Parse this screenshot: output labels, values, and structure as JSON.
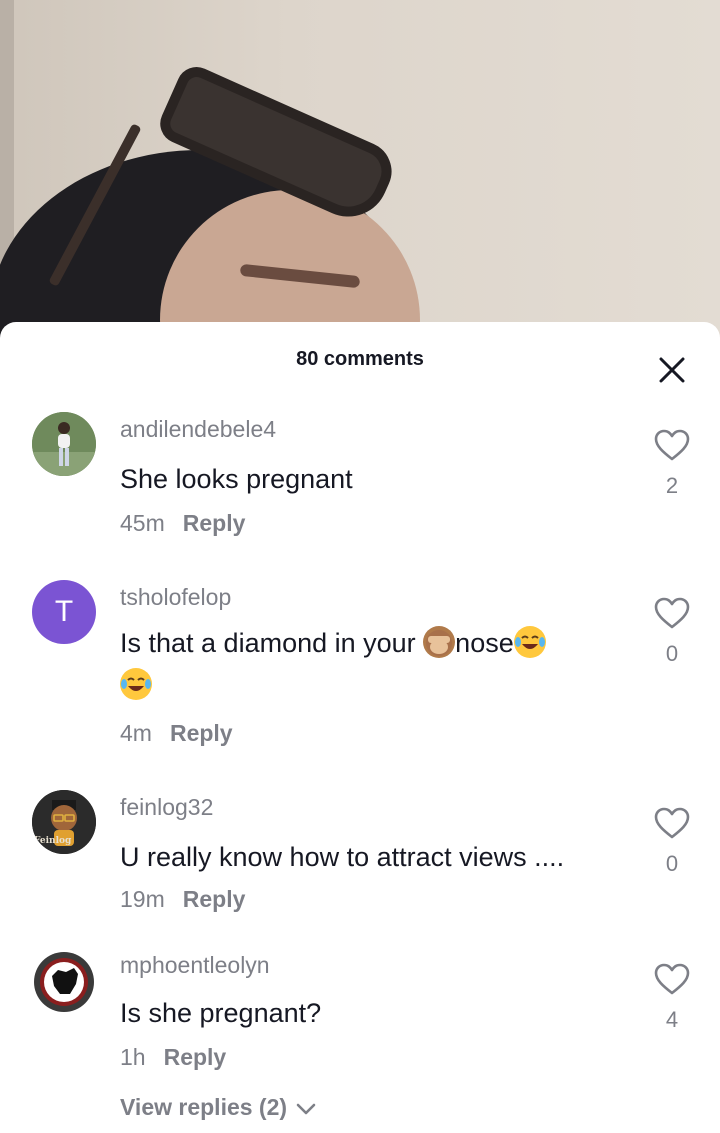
{
  "header": {
    "title": "80 comments"
  },
  "comments": [
    {
      "username": "andilendebele4",
      "text": "She looks pregnant",
      "time": "45m",
      "reply_label": "Reply",
      "likes": "2",
      "avatar_icon": "photo-avatar"
    },
    {
      "username": "tsholofelop",
      "text_parts": [
        "Is that a diamond in your ",
        "nose"
      ],
      "time": "4m",
      "reply_label": "Reply",
      "likes": "0",
      "avatar_letter": "T",
      "avatar_color": "#7b54d3"
    },
    {
      "username": "feinlog32",
      "text": "U really know how to attract views ....",
      "time": "19m",
      "reply_label": "Reply",
      "likes": "0",
      "avatar_icon": "cartoon-avatar",
      "avatar_logo_text": "Feinlog"
    },
    {
      "username": "mphoentleolyn",
      "text": "Is she pregnant?",
      "time": "1h",
      "reply_label": "Reply",
      "likes": "4",
      "avatar_icon": "fist-avatar",
      "view_replies": "View replies (2)"
    }
  ],
  "colors": {
    "text_primary": "#161823",
    "text_secondary": "#7d7f87",
    "sheet_bg": "#ffffff"
  }
}
